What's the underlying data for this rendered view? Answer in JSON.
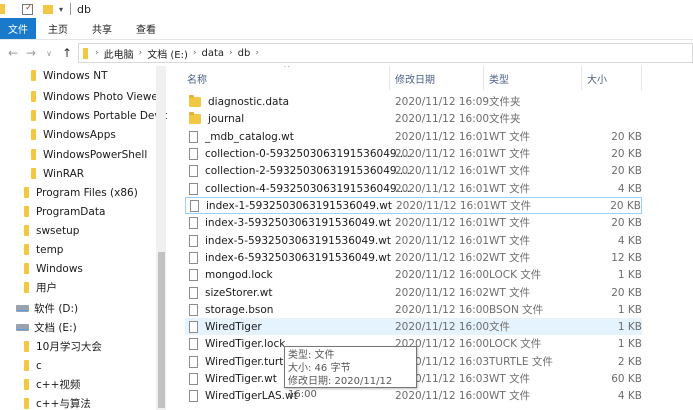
{
  "window": {
    "title": "db"
  },
  "ribbon": {
    "tabs": [
      "文件",
      "主页",
      "共享",
      "查看"
    ]
  },
  "nav": {
    "back": "←",
    "forward": "→",
    "recent": "∨",
    "up": "↑"
  },
  "address": {
    "segments": [
      "此电脑",
      "文档 (E:)",
      "data",
      "db"
    ]
  },
  "tree": [
    {
      "label": "Windows NT",
      "type": "folder"
    },
    {
      "label": "Windows Photo Viewer",
      "type": "folder"
    },
    {
      "label": "Windows Portable Devic",
      "type": "folder"
    },
    {
      "label": "WindowsApps",
      "type": "folder"
    },
    {
      "label": "WindowsPowerShell",
      "type": "folder"
    },
    {
      "label": "WinRAR",
      "type": "folder"
    },
    {
      "label": "Program Files (x86)",
      "type": "folder"
    },
    {
      "label": "ProgramData",
      "type": "folder"
    },
    {
      "label": "swsetup",
      "type": "folder"
    },
    {
      "label": "temp",
      "type": "folder"
    },
    {
      "label": "Windows",
      "type": "folder"
    },
    {
      "label": "用户",
      "type": "folder"
    },
    {
      "label": "软件 (D:)",
      "type": "drive"
    },
    {
      "label": "文档 (E:)",
      "type": "drive"
    },
    {
      "label": "10月学习大会",
      "type": "folder"
    },
    {
      "label": "c",
      "type": "folder"
    },
    {
      "label": "c++视频",
      "type": "folder"
    },
    {
      "label": "c++与算法",
      "type": "folder"
    }
  ],
  "columns": {
    "name": "名称",
    "date": "修改日期",
    "type": "类型",
    "size": "大小"
  },
  "files": [
    {
      "name": "diagnostic.data",
      "date": "2020/11/12 16:09",
      "type": "文件夹",
      "size": "",
      "kind": "folder"
    },
    {
      "name": "journal",
      "date": "2020/11/12 16:00",
      "type": "文件夹",
      "size": "",
      "kind": "folder"
    },
    {
      "name": "_mdb_catalog.wt",
      "date": "2020/11/12 16:01",
      "type": "WT 文件",
      "size": "20 KB",
      "kind": "file"
    },
    {
      "name": "collection-0-5932503063191536049....",
      "date": "2020/11/12 16:01",
      "type": "WT 文件",
      "size": "20 KB",
      "kind": "file"
    },
    {
      "name": "collection-2-5932503063191536049....",
      "date": "2020/11/12 16:01",
      "type": "WT 文件",
      "size": "20 KB",
      "kind": "file"
    },
    {
      "name": "collection-4-5932503063191536049....",
      "date": "2020/11/12 16:01",
      "type": "WT 文件",
      "size": "4 KB",
      "kind": "file"
    },
    {
      "name": "index-1-5932503063191536049.wt",
      "date": "2020/11/12 16:01",
      "type": "WT 文件",
      "size": "20 KB",
      "kind": "file"
    },
    {
      "name": "index-3-5932503063191536049.wt",
      "date": "2020/11/12 16:01",
      "type": "WT 文件",
      "size": "20 KB",
      "kind": "file"
    },
    {
      "name": "index-5-5932503063191536049.wt",
      "date": "2020/11/12 16:01",
      "type": "WT 文件",
      "size": "4 KB",
      "kind": "file"
    },
    {
      "name": "index-6-5932503063191536049.wt",
      "date": "2020/11/12 16:02",
      "type": "WT 文件",
      "size": "12 KB",
      "kind": "file"
    },
    {
      "name": "mongod.lock",
      "date": "2020/11/12 16:00",
      "type": "LOCK 文件",
      "size": "1 KB",
      "kind": "file"
    },
    {
      "name": "sizeStorer.wt",
      "date": "2020/11/12 16:02",
      "type": "WT 文件",
      "size": "20 KB",
      "kind": "file"
    },
    {
      "name": "storage.bson",
      "date": "2020/11/12 16:00",
      "type": "BSON 文件",
      "size": "1 KB",
      "kind": "file"
    },
    {
      "name": "WiredTiger",
      "date": "2020/11/12 16:00",
      "type": "文件",
      "size": "1 KB",
      "kind": "file"
    },
    {
      "name": "WiredTiger.lock",
      "date": "2020/11/12 16:00",
      "type": "LOCK 文件",
      "size": "1 KB",
      "kind": "file"
    },
    {
      "name": "WiredTiger.turtle",
      "date": "2020/11/12 16:03",
      "type": "TURTLE 文件",
      "size": "2 KB",
      "kind": "file"
    },
    {
      "name": "WiredTiger.wt",
      "date": "2020/11/12 16:03",
      "type": "WT 文件",
      "size": "60 KB",
      "kind": "file"
    },
    {
      "name": "WiredTigerLAS.wt",
      "date": "2020/11/12 16:00",
      "type": "WT 文件",
      "size": "4 KB",
      "kind": "file"
    }
  ],
  "tooltip": {
    "line1": "类型: 文件",
    "line2": "大小: 46 字节",
    "line3": "修改日期: 2020/11/12 16:00"
  }
}
